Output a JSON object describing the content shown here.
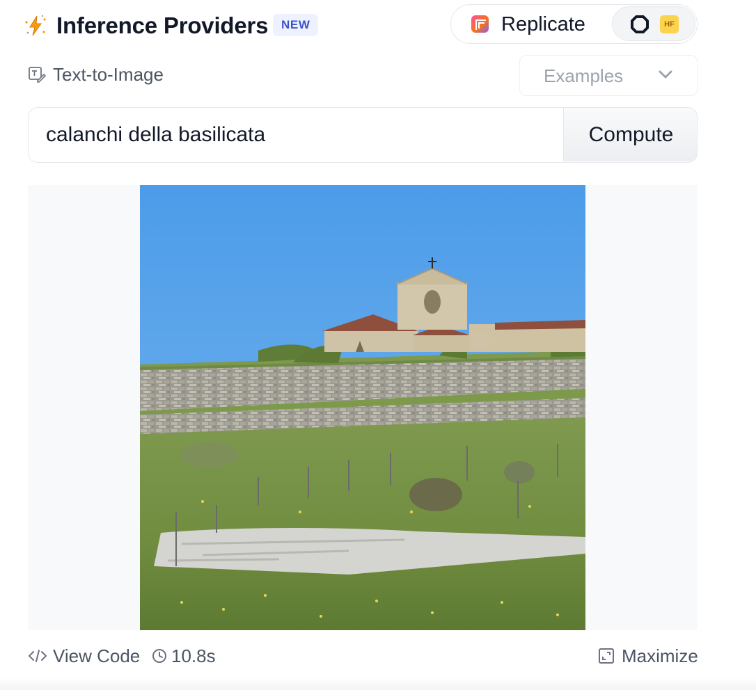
{
  "header": {
    "title": "Inference Providers",
    "badge": "NEW",
    "provider": {
      "name": "Replicate",
      "hf_badge": "HF"
    }
  },
  "task": {
    "label": "Text-to-Image",
    "icon": "text-to-image-icon"
  },
  "examples": {
    "label": "Examples",
    "icon": "chevron-down-icon"
  },
  "prompt": {
    "value": "calanchi della basilicata",
    "compute_label": "Compute"
  },
  "output": {
    "image": "generated-image-hilltop-church-stone-terraces"
  },
  "footer": {
    "view_code": "View Code",
    "duration": "10.8s",
    "maximize": "Maximize"
  },
  "colors": {
    "accent_badge_bg": "#eef2ff",
    "accent_badge_text": "#3b54c8",
    "hf_yellow": "#fbd34d",
    "muted_text": "#4b5563"
  }
}
